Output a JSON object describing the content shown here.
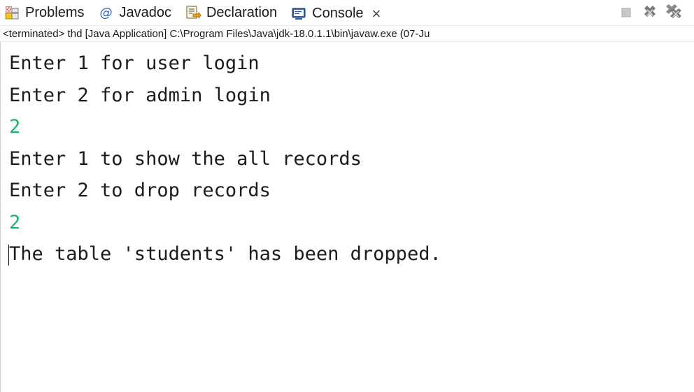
{
  "tabs": [
    {
      "label": "Problems",
      "icon": "problems-icon"
    },
    {
      "label": "Javadoc",
      "icon": "javadoc-icon",
      "glyph": "@"
    },
    {
      "label": "Declaration",
      "icon": "declaration-icon"
    },
    {
      "label": "Console",
      "icon": "console-icon",
      "active": true,
      "close": "×"
    }
  ],
  "toolbar": {
    "terminate_icon": "terminate-icon",
    "remove_launch_icon": "remove-launch-icon",
    "remove_all_icon": "remove-all-terminated-icon"
  },
  "status_line": "<terminated> thd [Java Application] C:\\Program Files\\Java\\jdk-18.0.1.1\\bin\\javaw.exe  (07-Ju",
  "console": {
    "lines": [
      {
        "text": "Enter 1 for user login",
        "type": "output"
      },
      {
        "text": "Enter 2 for admin login",
        "type": "output"
      },
      {
        "text": "2",
        "type": "input"
      },
      {
        "text": "Enter 1 to show the all records",
        "type": "output"
      },
      {
        "text": "Enter 2 to drop records",
        "type": "output"
      },
      {
        "text": "2",
        "type": "input"
      },
      {
        "text": "The table 'students' has been dropped.",
        "type": "output"
      }
    ]
  },
  "colors": {
    "input_text": "#17b56d",
    "output_text": "#1c1c1c"
  }
}
